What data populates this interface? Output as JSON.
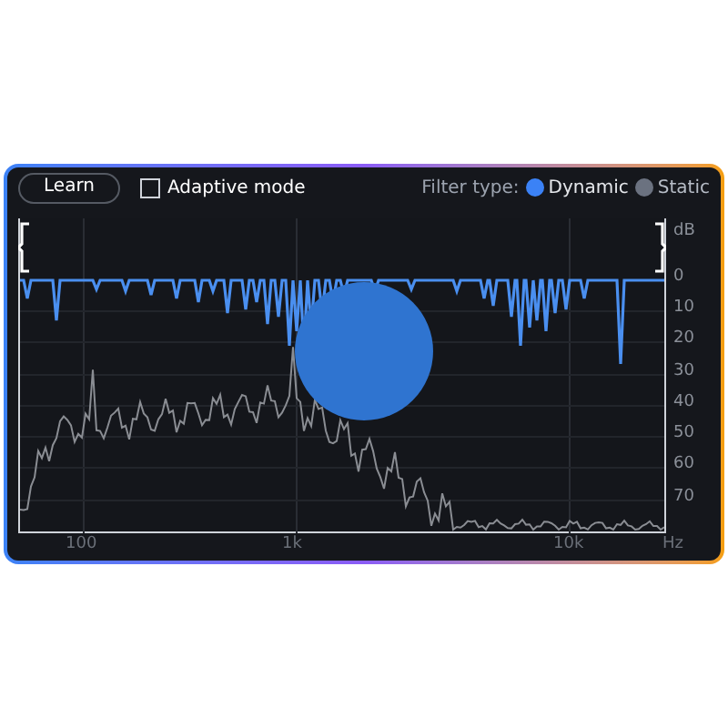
{
  "learn_button": {
    "label": "Learn"
  },
  "adaptive_mode": {
    "label": "Adaptive mode",
    "checked": false
  },
  "filter_type": {
    "label": "Filter type:",
    "options": [
      {
        "label": "Dynamic",
        "selected": true
      },
      {
        "label": "Static",
        "selected": false
      }
    ]
  },
  "spectrum": {
    "y_axis_labels": [
      "dB",
      "0",
      "10",
      "20",
      "30",
      "40",
      "50",
      "60",
      "70"
    ],
    "x_axis_labels": [
      "100",
      "1k",
      "10k",
      "Hz"
    ]
  }
}
